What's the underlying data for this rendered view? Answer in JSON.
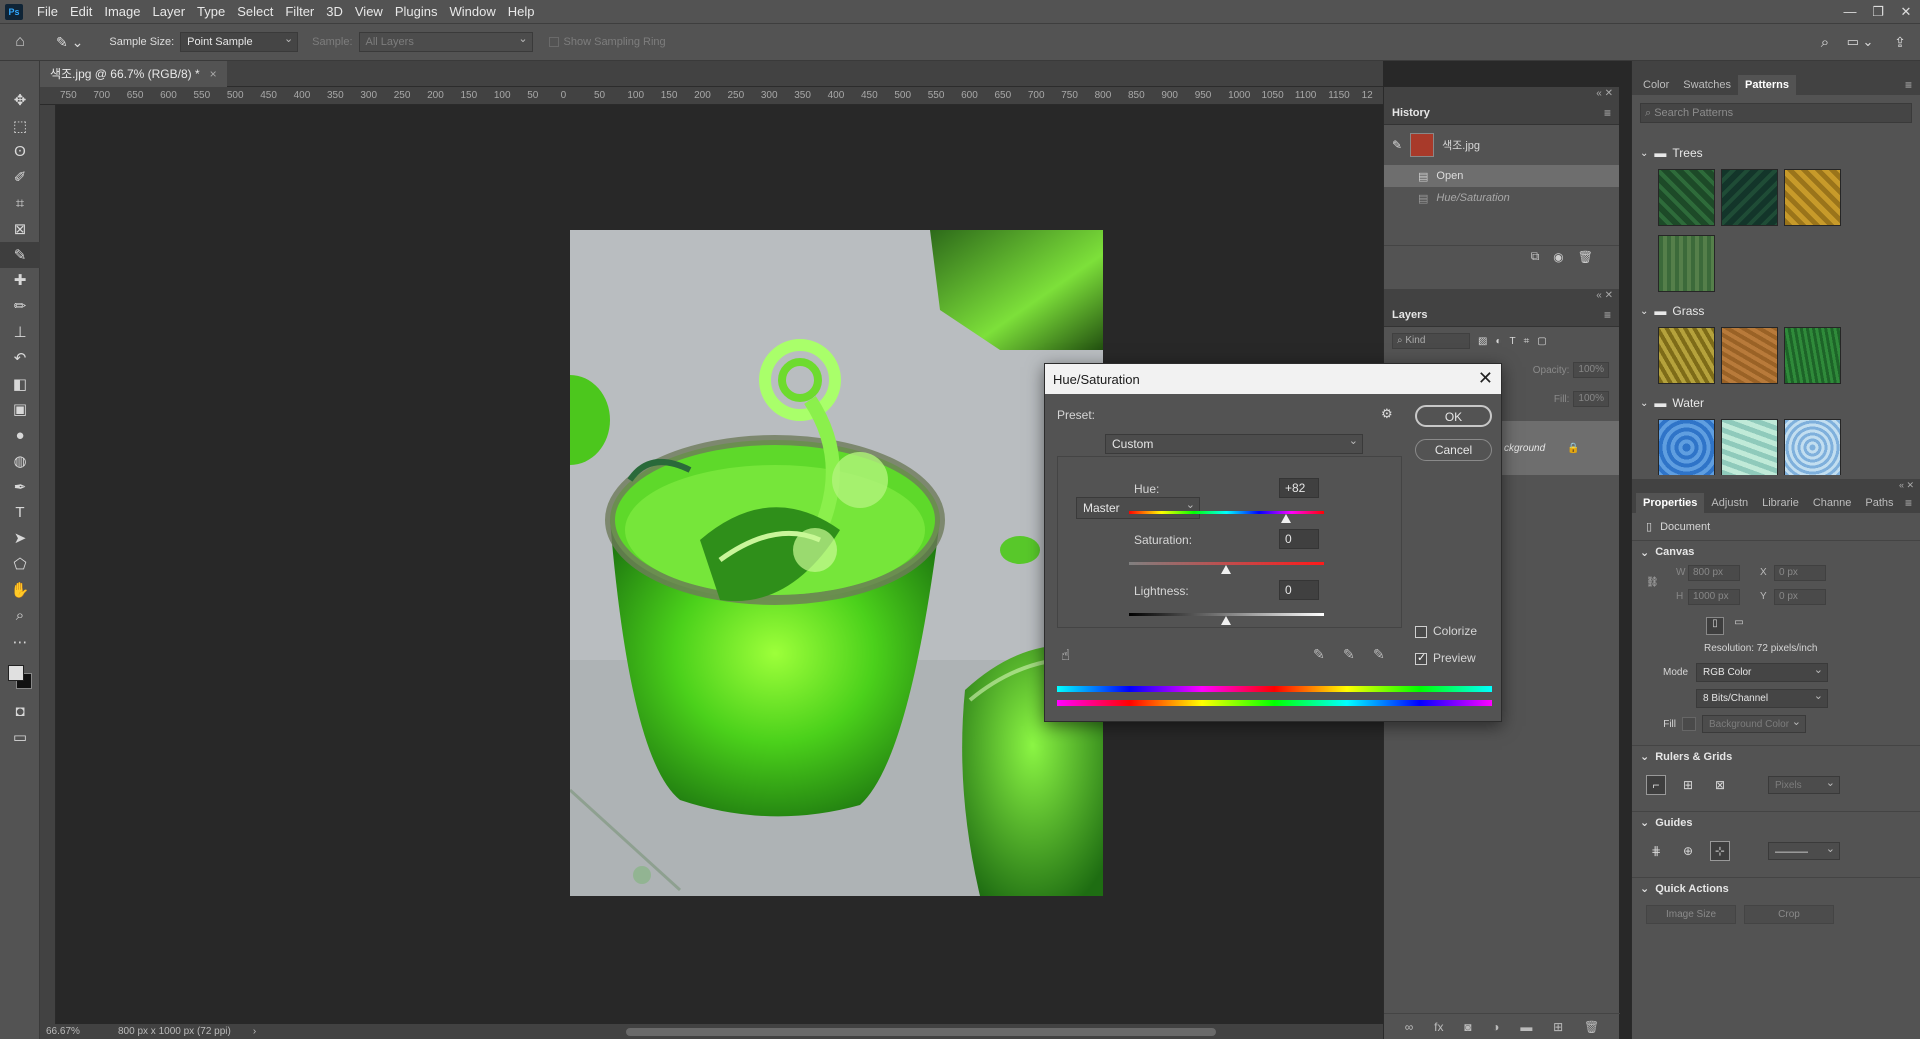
{
  "app": {
    "logo": "Ps",
    "menu": [
      "File",
      "Edit",
      "Image",
      "Layer",
      "Type",
      "Select",
      "Filter",
      "3D",
      "View",
      "Plugins",
      "Window",
      "Help"
    ],
    "window_controls": [
      "—",
      "❐",
      "✕"
    ]
  },
  "options_bar": {
    "sample_size_label": "Sample Size:",
    "sample_size_value": "Point Sample",
    "sample_label": "Sample:",
    "sample_value": "All Layers",
    "sampling_ring_label": "Show Sampling Ring"
  },
  "document": {
    "tab_title": "색조.jpg @ 66.7% (RGB/8) *",
    "tab_close": "×",
    "ruler_labels": [
      "750",
      "700",
      "650",
      "600",
      "550",
      "500",
      "450",
      "400",
      "350",
      "300",
      "250",
      "200",
      "150",
      "100",
      "50",
      "0",
      "50",
      "100",
      "150",
      "200",
      "250",
      "300",
      "350",
      "400",
      "450",
      "500",
      "550",
      "600",
      "650",
      "700",
      "750",
      "800",
      "850",
      "900",
      "950",
      "1000",
      "1050",
      "1100",
      "1150",
      "12"
    ],
    "zoom": "66.67%",
    "doc_info": "800 px x 1000 px (72 ppi)"
  },
  "history": {
    "title": "History",
    "snapshot_name": "색조.jpg",
    "items": [
      "Open",
      "Hue/Saturation"
    ]
  },
  "layers": {
    "title": "Layers",
    "kind_label": "Kind",
    "opacity_label": "Opacity:",
    "opacity_value": "100%",
    "fill_label": "Fill:",
    "fill_value": "100%",
    "layer_name": "ckground"
  },
  "patterns_panel": {
    "tabs": [
      "Color",
      "Swatches",
      "Patterns"
    ],
    "active_tab": "Patterns",
    "search_placeholder": "Search Patterns",
    "groups": [
      {
        "name": "Trees",
        "swatches": [
          "#1f4a2a",
          "#163a24",
          "#a07a1c",
          "#3f6a3c"
        ]
      },
      {
        "name": "Grass",
        "swatches": [
          "#8c7a1e",
          "#a5682a",
          "#1f6a2a"
        ]
      },
      {
        "name": "Water",
        "swatches": [
          "#3a7ed0",
          "#9fd2c8",
          "#8ab8e0"
        ]
      }
    ]
  },
  "properties": {
    "tabs": [
      "Properties",
      "Adjustn",
      "Librarie",
      "Channe",
      "Paths"
    ],
    "document_label": "Document",
    "canvas_title": "Canvas",
    "w_label": "W",
    "w_value": "800 px",
    "h_label": "H",
    "h_value": "1000 px",
    "x_label": "X",
    "x_value": "0 px",
    "y_label": "Y",
    "y_value": "0 px",
    "resolution": "Resolution: 72 pixels/inch",
    "mode_label": "Mode",
    "mode_value": "RGB Color",
    "bits_value": "8 Bits/Channel",
    "fill_label": "Fill",
    "fill_value": "Background Color",
    "rulers_title": "Rulers & Grids",
    "units_value": "Pixels",
    "guides_title": "Guides",
    "quick_actions_title": "Quick Actions",
    "image_size_button": "Image Size",
    "crop_button": "Crop"
  },
  "hue_saturation": {
    "title": "Hue/Saturation",
    "preset_label": "Preset:",
    "preset_value": "Custom",
    "ok_label": "OK",
    "cancel_label": "Cancel",
    "channel_value": "Master",
    "hue_label": "Hue:",
    "hue_value": "+82",
    "saturation_label": "Saturation:",
    "saturation_value": "0",
    "lightness_label": "Lightness:",
    "lightness_value": "0",
    "colorize_label": "Colorize",
    "colorize_checked": false,
    "preview_label": "Preview",
    "preview_checked": true
  },
  "colors": {
    "ui_dark": "#535353",
    "canvas_bg": "#282828",
    "accent_green": "#3fd12a"
  }
}
